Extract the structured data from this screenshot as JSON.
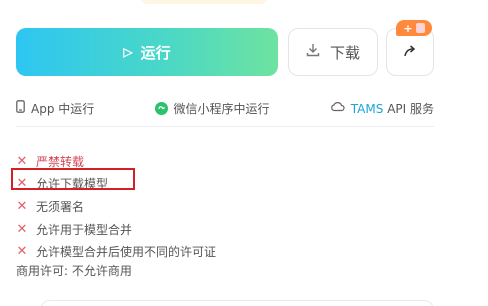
{
  "actions": {
    "run_label": "运行",
    "download_label": "下载",
    "badge_text": "+"
  },
  "run_options": {
    "app": "App 中运行",
    "wechat": "微信小程序中运行",
    "tams_brand": "TAMS",
    "tams_rest": "API 服务"
  },
  "permissions": [
    {
      "label": "严禁转载",
      "allowed": false,
      "emphasis": "red"
    },
    {
      "label": "允许下载模型",
      "allowed": false
    },
    {
      "label": "无须署名",
      "allowed": false
    },
    {
      "label": "允许用于模型合并",
      "allowed": false
    },
    {
      "label": "允许模型合并后使用不同的许可证",
      "allowed": false
    }
  ],
  "license": "商用许可: 不允许商用",
  "icons": {
    "run": "play-icon",
    "download": "download-icon",
    "share": "share-icon",
    "app": "phone-icon",
    "wechat": "wechat-miniprogram-icon",
    "tams": "cloud-icon",
    "deny": "x-icon"
  },
  "colors": {
    "accent_gradient_start": "#2dc6f2",
    "accent_gradient_end": "#6ee3a0",
    "deny": "#e0606b",
    "badge": "#ff8a3d",
    "tams": "#1aa6d8",
    "highlight": "#d31f26"
  }
}
